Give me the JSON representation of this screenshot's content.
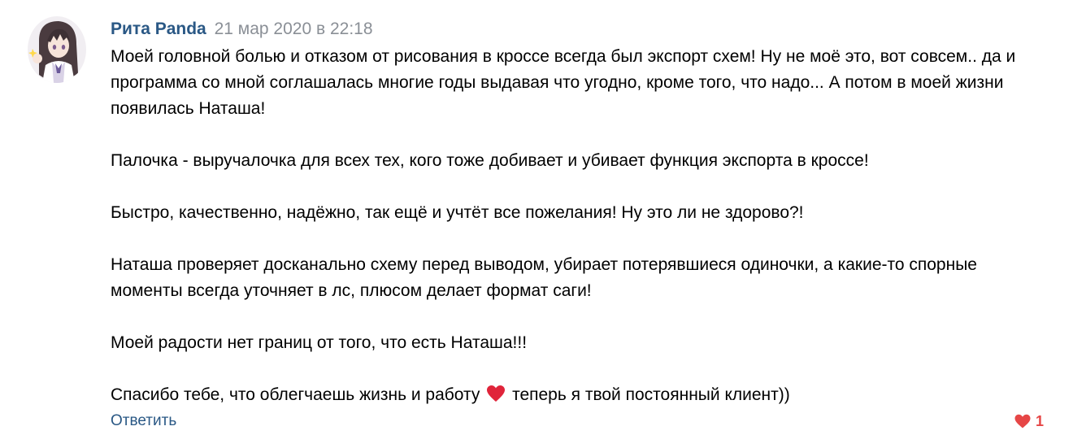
{
  "comment": {
    "author": "Рита Panda",
    "date": "21 мар 2020 в 22:18",
    "paragraphs": [
      "Моей головной болью и отказом от рисования в кроссе всегда был экспорт схем! Ну не моё это, вот совсем.. да и программа со мной соглашалась многие годы выдавая что угодно, кроме того, что надо... А потом в моей жизни появилась Наташа!",
      "Палочка - выручалочка для всех тех, кого тоже добивает и убивает функция экспорта в кроссе!",
      "Быстро, качественно, надёжно, так ещё и учтёт все пожелания! Ну это ли не здорово?!",
      "Наташа проверяет досканально схему перед выводом, убирает потерявшиеся одиночки, а какие-то спорные моменты всегда уточняет в лс, плюсом делает формат саги!",
      "Моей радости нет границ от того, что есть Наташа!!!"
    ],
    "last_paragraph": {
      "before_emoji": "Спасибо тебе, что облегчаешь жизнь и работу",
      "emoji": "heart-emoji",
      "after_emoji": "теперь я твой постоянный клиент))"
    },
    "reply_label": "Ответить",
    "like_icon": "heart-icon",
    "like_count": "1"
  },
  "colors": {
    "author": "#2a5885",
    "date": "#8a8f96",
    "link": "#2a5885",
    "like": "#e64646"
  }
}
